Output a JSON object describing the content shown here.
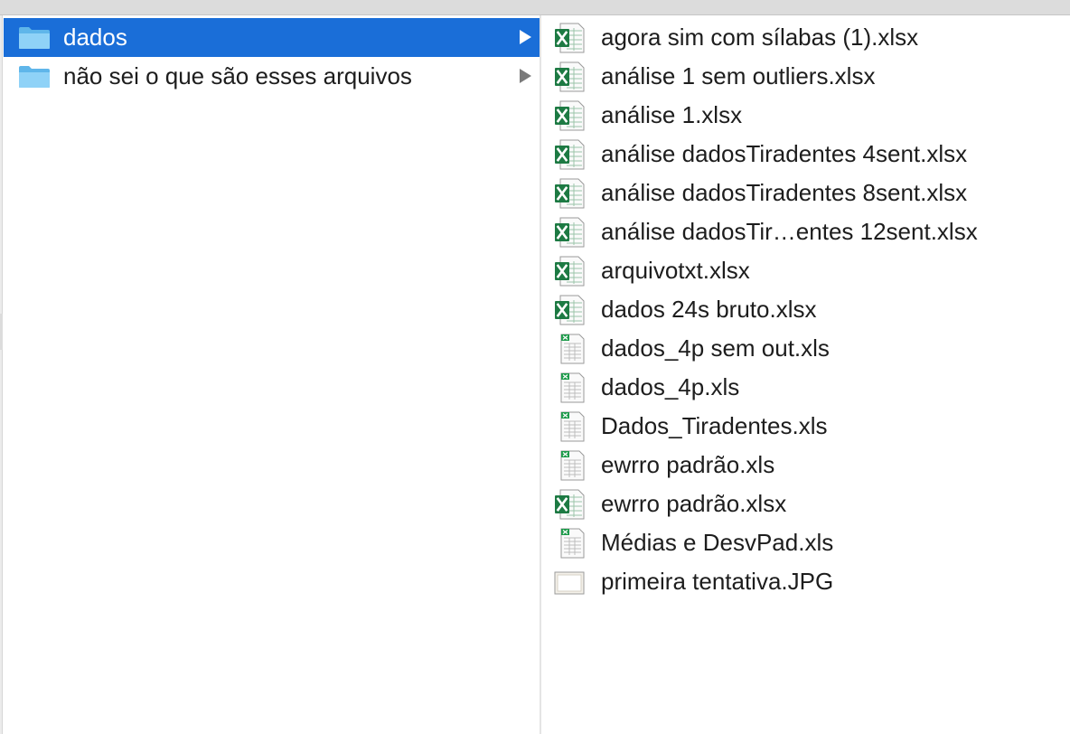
{
  "folders": [
    {
      "name": "dados",
      "selected": true,
      "icon": "folder-icon"
    },
    {
      "name": "não sei o que são esses arquivos",
      "selected": false,
      "icon": "folder-icon"
    }
  ],
  "files": [
    {
      "name": "agora sim com sílabas (1).xlsx",
      "icon": "xlsx-icon"
    },
    {
      "name": "análise 1 sem outliers.xlsx",
      "icon": "xlsx-icon"
    },
    {
      "name": "análise 1.xlsx",
      "icon": "xlsx-icon"
    },
    {
      "name": "análise dadosTiradentes 4sent.xlsx",
      "icon": "xlsx-icon"
    },
    {
      "name": "análise dadosTiradentes 8sent.xlsx",
      "icon": "xlsx-icon"
    },
    {
      "name": "análise dadosTir…entes 12sent.xlsx",
      "icon": "xlsx-icon"
    },
    {
      "name": "arquivotxt.xlsx",
      "icon": "xlsx-icon"
    },
    {
      "name": "dados 24s bruto.xlsx",
      "icon": "xlsx-icon"
    },
    {
      "name": "dados_4p sem out.xls",
      "icon": "xls-icon"
    },
    {
      "name": "dados_4p.xls",
      "icon": "xls-icon"
    },
    {
      "name": "Dados_Tiradentes.xls",
      "icon": "xls-icon"
    },
    {
      "name": "ewrro padrão.xls",
      "icon": "xls-icon"
    },
    {
      "name": "ewrro padrão.xlsx",
      "icon": "xlsx-icon"
    },
    {
      "name": "Médias e DesvPad.xls",
      "icon": "xls-icon"
    },
    {
      "name": "primeira tentativa.JPG",
      "icon": "jpg-icon"
    }
  ],
  "colors": {
    "selection": "#1a6ed8",
    "folder": "#6cc3f2",
    "excel_green": "#1d7a43"
  }
}
